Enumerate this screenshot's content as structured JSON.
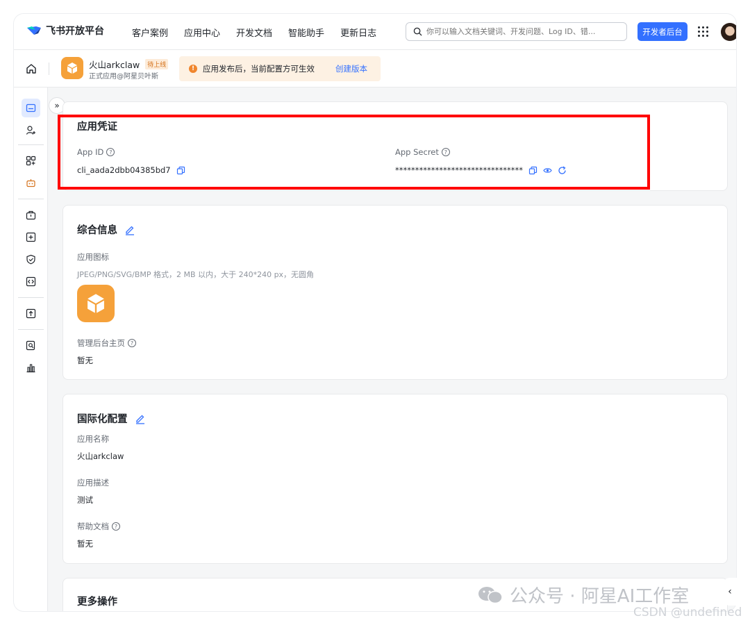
{
  "topnav": {
    "logo_text": "飞书开放平台",
    "links": [
      "客户案例",
      "应用中心",
      "开发文档",
      "智能助手",
      "更新日志"
    ],
    "search_placeholder": "你可以输入文档关键词、开发问题、Log ID、错...",
    "dev_button": "开发者后台"
  },
  "appbar": {
    "app_name": "火山arkclaw",
    "status_badge": "待上线",
    "app_subtitle": "正式应用@阿星贝叶斯",
    "notice_text": "应用发布后，当前配置方可生效",
    "notice_link": "创建版本"
  },
  "credentials": {
    "title": "应用凭证",
    "app_id_label": "App ID",
    "app_id_value": "cli_aada2dbb04385bd7",
    "app_secret_label": "App Secret",
    "app_secret_value": "********************************"
  },
  "general": {
    "title": "综合信息",
    "icon_label": "应用图标",
    "icon_hint": "JPEG/PNG/SVG/BMP 格式，2 MB 以内，大于 240*240 px，无圆角",
    "homepage_label": "管理后台主页",
    "homepage_value": "暂无"
  },
  "i18n": {
    "title": "国际化配置",
    "name_label": "应用名称",
    "name_value": "火山arkclaw",
    "desc_label": "应用描述",
    "desc_value": "测试",
    "help_label": "帮助文档",
    "help_value": "暂无"
  },
  "more": {
    "title": "更多操作"
  },
  "watermark": {
    "text": "公众号 · 阿星AI工作室",
    "csdn": "CSDN @undefined"
  },
  "colors": {
    "accent": "#3370ff",
    "app_icon": "#f5a13a",
    "highlight": "#ff0000"
  }
}
